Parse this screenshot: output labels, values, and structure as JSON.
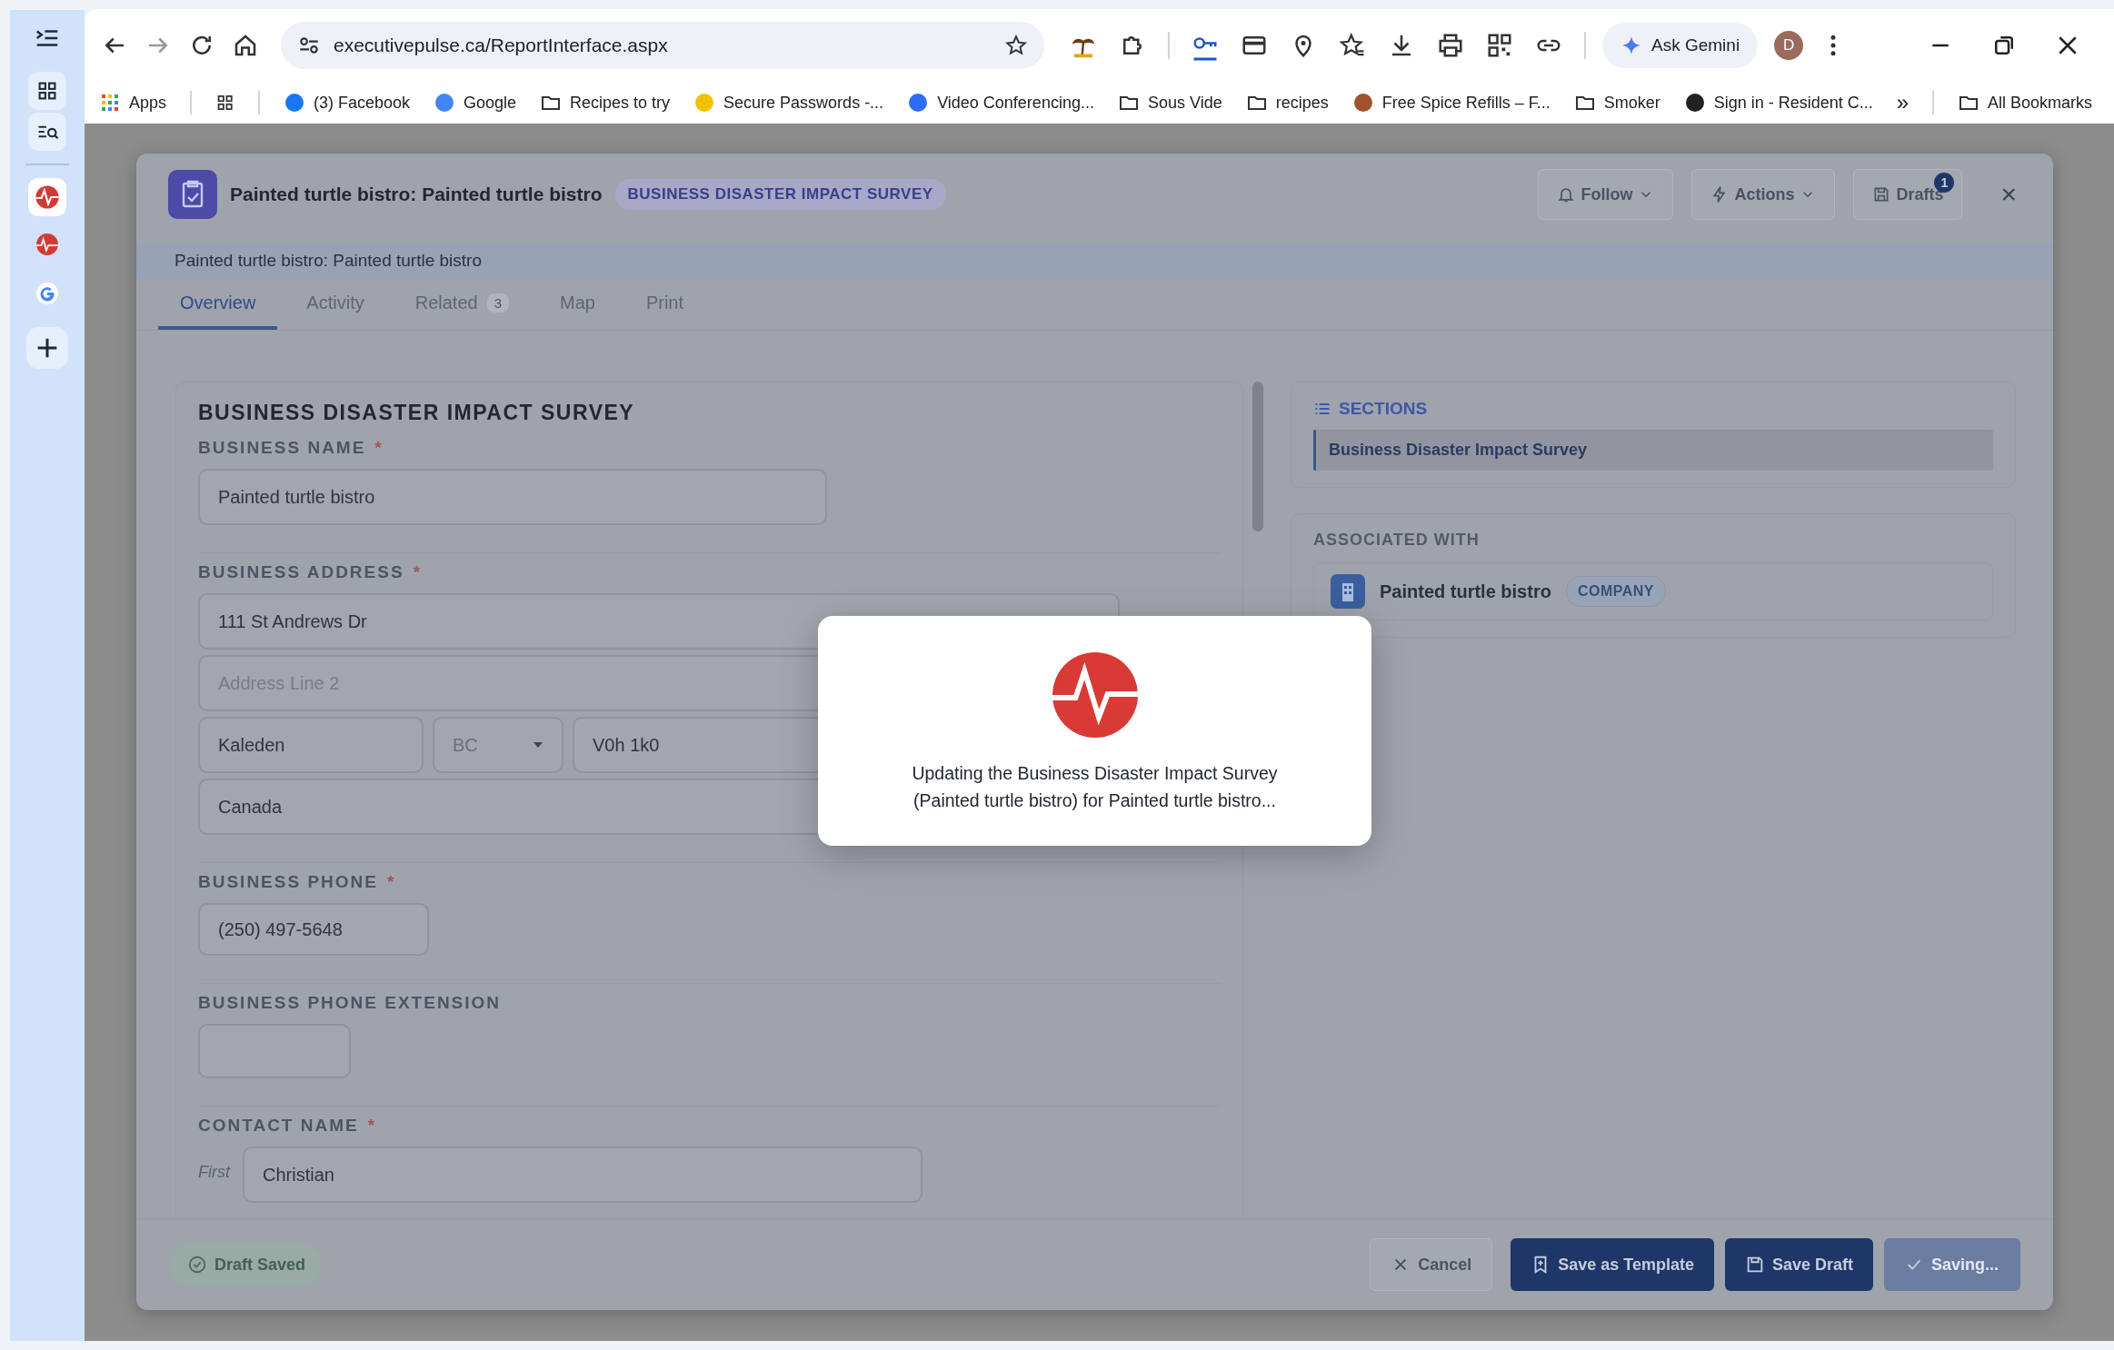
{
  "browser": {
    "address": "executivepulse.ca/ReportInterface.aspx",
    "gemini": "Ask Gemini",
    "profile": "D",
    "bookmarks": [
      {
        "kind": "apps",
        "label": "Apps"
      },
      {
        "kind": "grid"
      },
      {
        "kind": "site",
        "label": "(3) Facebook",
        "color": "#1877f2"
      },
      {
        "kind": "site",
        "label": "Google",
        "color": "#4285f4"
      },
      {
        "kind": "folder",
        "label": "Recipes to try"
      },
      {
        "kind": "site",
        "label": "Secure Passwords -...",
        "color": "#f2c200"
      },
      {
        "kind": "site",
        "label": "Video Conferencing...",
        "color": "#2d6cf6"
      },
      {
        "kind": "folder",
        "label": "Sous Vide"
      },
      {
        "kind": "folder",
        "label": "recipes"
      },
      {
        "kind": "site",
        "label": "Free Spice Refills – F...",
        "color": "#a0522d"
      },
      {
        "kind": "folder",
        "label": "Smoker"
      },
      {
        "kind": "site",
        "label": "Sign in - Resident C...",
        "color": "#222222"
      }
    ],
    "overflow": "»",
    "all_bookmarks": "All Bookmarks"
  },
  "modal": {
    "title": "Painted turtle bistro: Painted turtle bistro",
    "badge": "BUSINESS DISASTER IMPACT SURVEY",
    "actions": [
      {
        "kind": "follow",
        "label": "Follow"
      },
      {
        "kind": "actions",
        "label": "Actions"
      },
      {
        "kind": "drafts",
        "label": "Drafts",
        "count": "1"
      }
    ],
    "close": "×",
    "subtitle": "Painted turtle bistro: Painted turtle bistro",
    "tabs": [
      {
        "label": "Overview",
        "selected": true
      },
      {
        "label": "Activity",
        "selected": false
      },
      {
        "label": "Related",
        "count": "3",
        "selected": false
      },
      {
        "label": "Map",
        "selected": false
      },
      {
        "label": "Print",
        "selected": false
      }
    ],
    "form": {
      "title": "BUSINESS DISASTER IMPACT SURVEY",
      "fields": [
        {
          "kind": "text",
          "label": "BUSINESS NAME",
          "required_mark": "*",
          "value": "Painted turtle bistro"
        },
        {
          "kind": "address",
          "label": "BUSINESS ADDRESS",
          "required_mark": "*",
          "street": "111 St Andrews Dr",
          "line2_placeholder": "Address Line 2",
          "city": "Kaleden",
          "state": "BC",
          "postal": "V0h 1k0",
          "country": "Canada"
        },
        {
          "kind": "phone",
          "label": "BUSINESS PHONE",
          "required_mark": "*",
          "value": "(250) 497-5648"
        },
        {
          "kind": "extension",
          "label": "BUSINESS PHONE EXTENSION"
        },
        {
          "kind": "name",
          "label": "CONTACT NAME",
          "required_mark": "*",
          "first_label": "First",
          "value": "Christian"
        }
      ]
    },
    "sections": {
      "title": "SECTIONS",
      "items": [
        {
          "label": "Business Disaster Impact Survey",
          "selected": true
        }
      ]
    },
    "associated": {
      "title": "ASSOCIATED WITH",
      "items": [
        {
          "name": "Painted turtle bistro",
          "type": "COMPANY"
        }
      ]
    },
    "footer": {
      "status": "Draft Saved",
      "buttons": [
        {
          "kind": "cancel",
          "label": "Cancel",
          "disabled": false
        },
        {
          "kind": "template",
          "label": "Save as Template",
          "disabled": false
        },
        {
          "kind": "draft",
          "label": "Save Draft",
          "disabled": false
        },
        {
          "kind": "saving",
          "label": "Saving...",
          "disabled": true
        }
      ]
    }
  },
  "popup": {
    "message": "Updating the Business Disaster Impact Survey (Painted turtle bistro) for Painted turtle bistro..."
  }
}
